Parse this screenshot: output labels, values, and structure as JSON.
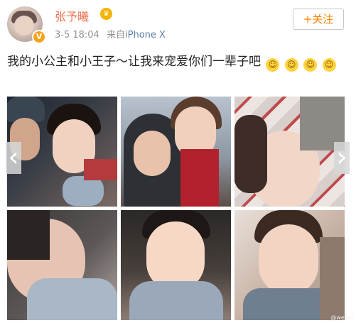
{
  "user": {
    "name": "张予曦",
    "time": "3-5 18:04",
    "source_prefix": "来自",
    "source": "iPhone X"
  },
  "follow_button": {
    "label": "+关注"
  },
  "post": {
    "text": "我的小公主和小王子～让我来宠爱你们一辈子吧"
  },
  "icons": {
    "verified": "verified-badge-icon",
    "vip": "vip-crown-icon",
    "emoji": "blushing-face-emoji",
    "prev": "chevron-left-icon",
    "next": "chevron-right-icon"
  },
  "watermark": "@weibo"
}
